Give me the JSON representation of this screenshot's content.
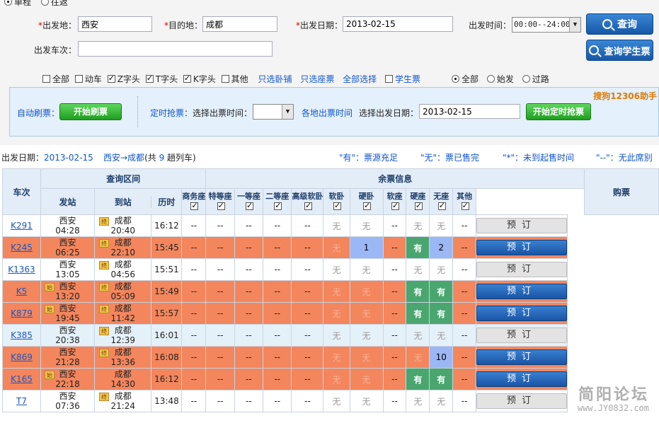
{
  "trip": {
    "single": "单程",
    "round": "往返"
  },
  "form": {
    "from_label": "出发地：",
    "from_value": "西安",
    "to_label": "目的地：",
    "to_value": "成都",
    "date_label": "出发日期：",
    "date_value": "2013-02-15",
    "time_label": "出发时间：",
    "time_value": "00:00--24:00",
    "train_label": "出发车次：",
    "train_value": "",
    "query_btn": "查询",
    "student_btn": "查询学生票"
  },
  "filters": {
    "types": [
      {
        "label": "全部",
        "checked": false
      },
      {
        "label": "动车",
        "checked": false
      },
      {
        "label": "Z字头",
        "checked": true
      },
      {
        "label": "T字头",
        "checked": true
      },
      {
        "label": "K字头",
        "checked": true
      },
      {
        "label": "其他",
        "checked": false
      }
    ],
    "link_sleeper": "只选卧铺",
    "link_seat": "只选座票",
    "link_all": "全部选择",
    "student": "学生票",
    "station_opts": [
      {
        "label": "全部",
        "on": true
      },
      {
        "label": "始发",
        "on": false
      },
      {
        "label": "过路",
        "on": false
      }
    ]
  },
  "auto": {
    "brand": "搜狗12306助手",
    "refresh_label": "自动刷票：",
    "refresh_btn": "开始刷票",
    "timed_label": "定时抢票：",
    "choose_time": "选择出票时间：",
    "time_value": "",
    "places_link": "各地出票时间",
    "choose_date": "选择出发日期：",
    "date_value": "2013-02-15",
    "timed_btn": "开始定时抢票"
  },
  "info": {
    "date_label": "出发日期：",
    "date_value": "2013-02-15",
    "route": "西安→成都",
    "count_pre": "(共",
    "count": "9",
    "count_post": "趟列车)",
    "legend_have": "\"有\"：票源充足",
    "legend_none": "\"无\"：票已售完",
    "legend_star": "\"*\"：未到起售时间",
    "legend_dash": "\"--\"：无此席别"
  },
  "table": {
    "h_train": "车次",
    "h_section": "查询区间",
    "h_remain": "余票信息",
    "h_buy": "购票",
    "h_from": "发站",
    "h_to": "到站",
    "h_duration": "历时",
    "seat_types": [
      "商务座",
      "特等座",
      "一等座",
      "二等座",
      "高级软卧",
      "软卧",
      "硬卧",
      "软座",
      "硬座",
      "无座",
      "其他"
    ],
    "book_label": "预订",
    "rows": [
      {
        "train": "K291",
        "from": "西安",
        "dep": "04:28",
        "from_tag": "",
        "to": "成都",
        "arr": "20:40",
        "to_tag": "终",
        "dur": "16:12",
        "seats": [
          "--",
          "--",
          "--",
          "--",
          "--",
          "无",
          "无",
          "--",
          "无",
          "无",
          "--"
        ],
        "bookable": false
      },
      {
        "train": "K245",
        "from": "西安",
        "dep": "06:25",
        "from_tag": "",
        "to": "成都",
        "arr": "22:10",
        "to_tag": "终",
        "dur": "15:45",
        "seats": [
          "--",
          "--",
          "--",
          "--",
          "--",
          "无",
          "1",
          "--",
          "有",
          "2",
          "--"
        ],
        "bookable": true
      },
      {
        "train": "K1363",
        "from": "西安",
        "dep": "13:05",
        "from_tag": "",
        "to": "成都",
        "arr": "04:56",
        "to_tag": "终",
        "dur": "15:51",
        "seats": [
          "--",
          "--",
          "--",
          "--",
          "--",
          "无",
          "无",
          "--",
          "无",
          "无",
          "--"
        ],
        "bookable": false
      },
      {
        "train": "K5",
        "from": "西安",
        "dep": "13:20",
        "from_tag": "始",
        "to": "成都",
        "arr": "05:09",
        "to_tag": "终",
        "dur": "15:49",
        "seats": [
          "--",
          "--",
          "--",
          "--",
          "--",
          "无",
          "无",
          "--",
          "有",
          "有",
          "--"
        ],
        "bookable": true
      },
      {
        "train": "K879",
        "from": "西安",
        "dep": "19:45",
        "from_tag": "始",
        "to": "成都",
        "arr": "11:42",
        "to_tag": "终",
        "dur": "15:57",
        "seats": [
          "--",
          "--",
          "--",
          "--",
          "--",
          "无",
          "无",
          "--",
          "有",
          "有",
          "--"
        ],
        "bookable": true
      },
      {
        "train": "K385",
        "from": "西安",
        "dep": "20:38",
        "from_tag": "",
        "to": "成都",
        "arr": "12:39",
        "to_tag": "终",
        "dur": "16:01",
        "seats": [
          "--",
          "--",
          "--",
          "--",
          "--",
          "无",
          "无",
          "--",
          "无",
          "无",
          "--"
        ],
        "bookable": false
      },
      {
        "train": "K869",
        "from": "西安",
        "dep": "21:28",
        "from_tag": "",
        "to": "成都",
        "arr": "13:36",
        "to_tag": "终",
        "dur": "16:08",
        "seats": [
          "--",
          "--",
          "--",
          "--",
          "--",
          "无",
          "无",
          "--",
          "无",
          "10",
          "--"
        ],
        "bookable": true
      },
      {
        "train": "K165",
        "from": "西安",
        "dep": "22:18",
        "from_tag": "始",
        "to": "成都",
        "arr": "14:30",
        "to_tag": "",
        "dur": "16:12",
        "seats": [
          "--",
          "--",
          "--",
          "--",
          "--",
          "无",
          "无",
          "--",
          "有",
          "有",
          "--"
        ],
        "bookable": true
      },
      {
        "train": "T7",
        "from": "西安",
        "dep": "07:36",
        "from_tag": "",
        "to": "成都",
        "arr": "21:24",
        "to_tag": "终",
        "dur": "13:48",
        "seats": [
          "--",
          "--",
          "--",
          "--",
          "--",
          "无",
          "无",
          "--",
          "无",
          "无",
          "--"
        ],
        "bookable": false
      }
    ]
  },
  "watermark": {
    "text": "简阳论坛",
    "url": "www.JY0832.com"
  }
}
